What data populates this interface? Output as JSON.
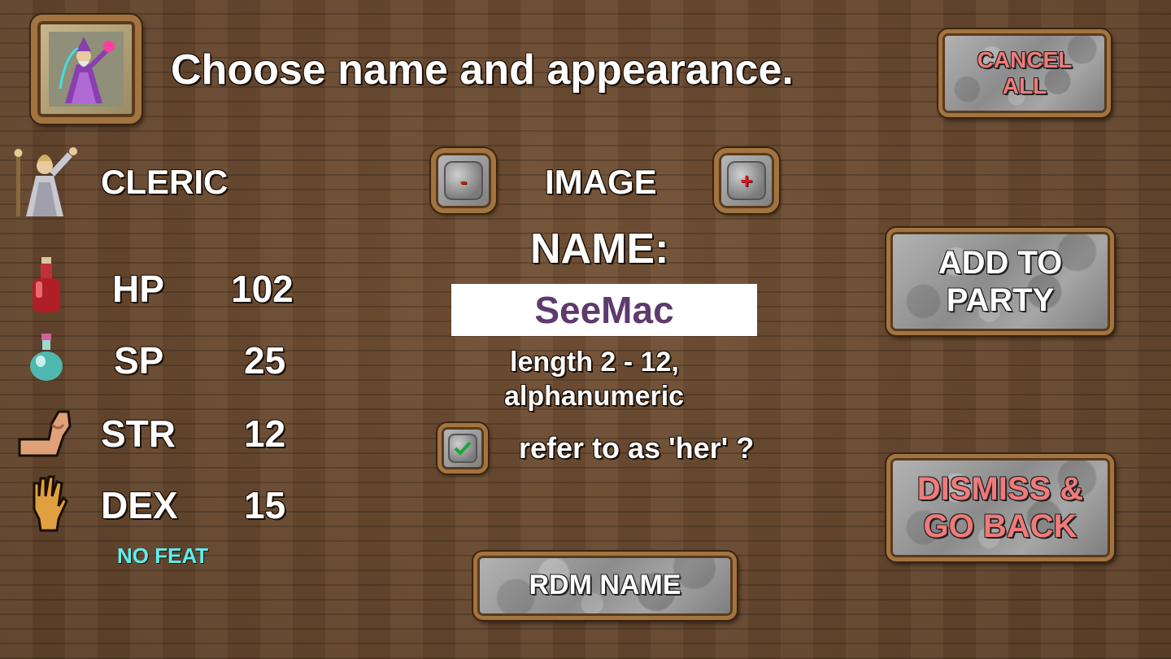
{
  "header": {
    "title": "Choose name and appearance."
  },
  "buttons": {
    "cancel_all": "CANCEL\nALL",
    "add_to_party": "ADD TO\nPARTY",
    "dismiss_go_back": "DISMISS &\nGO BACK",
    "random_name": "RDM NAME",
    "image_minus": "-",
    "image_plus": "+"
  },
  "character": {
    "class": "CLERIC",
    "feat": "NO FEAT",
    "stats": [
      {
        "label": "HP",
        "value": "102",
        "icon": "red-potion-icon"
      },
      {
        "label": "SP",
        "value": "25",
        "icon": "blue-potion-icon"
      },
      {
        "label": "STR",
        "value": "12",
        "icon": "arm-strength-icon"
      },
      {
        "label": "DEX",
        "value": "15",
        "icon": "hand-dexterity-icon"
      }
    ]
  },
  "image_selector": {
    "label": "IMAGE"
  },
  "name_field": {
    "label": "NAME:",
    "value": "SeeMac",
    "hint_line1": "length 2 - 12,",
    "hint_line2": "alphanumeric"
  },
  "pronoun_option": {
    "label": "refer to as 'her' ?",
    "checked": true
  },
  "colors": {
    "background": "#6a4a30",
    "frame": "#a2743f",
    "name_text": "#5e3a6e",
    "warning_text": "#f07a7a",
    "feat_text": "#5cf0f0"
  }
}
